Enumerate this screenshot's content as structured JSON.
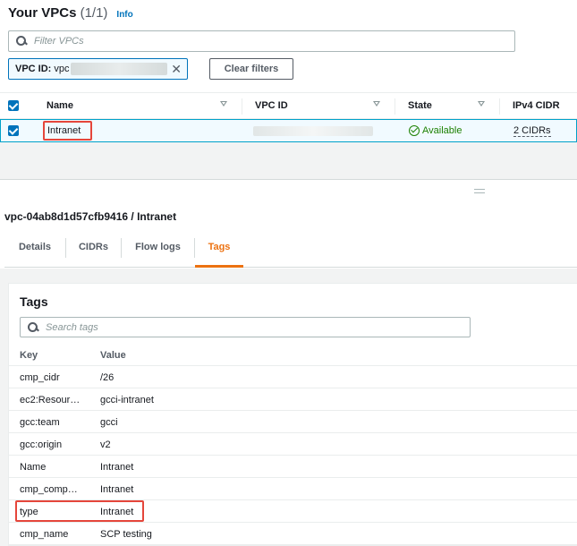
{
  "header": {
    "title": "Your VPCs",
    "count": "(1/1)",
    "info_link": "Info"
  },
  "filter": {
    "placeholder": "Filter VPCs",
    "token_key": "VPC ID:",
    "token_value": "vpc",
    "clear_label": "Clear filters"
  },
  "table": {
    "columns": [
      "Name",
      "VPC ID",
      "State",
      "IPv4 CIDR"
    ],
    "rows": [
      {
        "name": "Intranet",
        "vpc_id": "",
        "state": "Available",
        "ipv4_cidr": "2 CIDRs"
      }
    ]
  },
  "detail": {
    "title": "vpc-04ab8d1d57cfb9416 / Intranet",
    "tabs": [
      "Details",
      "CIDRs",
      "Flow logs",
      "Tags"
    ],
    "active_tab": "Tags"
  },
  "tags": {
    "title": "Tags",
    "search_placeholder": "Search tags",
    "columns": [
      "Key",
      "Value"
    ],
    "rows": [
      {
        "key": "cmp_cidr",
        "value": "/26"
      },
      {
        "key": "ec2:Resour…",
        "value": "gcci-intranet"
      },
      {
        "key": "gcc:team",
        "value": "gcci"
      },
      {
        "key": "gcc:origin",
        "value": "v2"
      },
      {
        "key": "Name",
        "value": "Intranet"
      },
      {
        "key": "cmp_comp…",
        "value": "Intranet"
      },
      {
        "key": "type",
        "value": "Intranet"
      },
      {
        "key": "cmp_name",
        "value": "SCP testing"
      }
    ]
  },
  "colors": {
    "accent": "#0073bb",
    "active_tab": "#ec7211",
    "status_ok": "#1d8102",
    "highlight": "#e5463b"
  }
}
